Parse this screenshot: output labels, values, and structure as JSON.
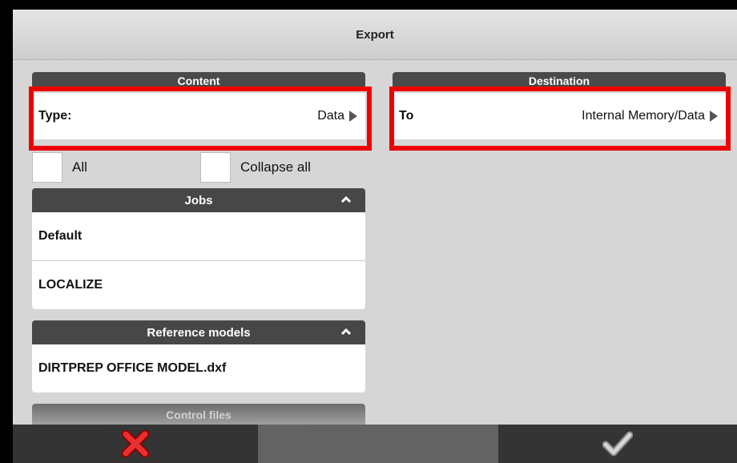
{
  "window": {
    "title": "Export"
  },
  "content": {
    "header": "Content",
    "type_label": "Type:",
    "type_value": "Data"
  },
  "destination": {
    "header": "Destination",
    "to_label": "To",
    "to_value": "Internal Memory/Data"
  },
  "options": {
    "all_label": "All",
    "collapse_label": "Collapse all"
  },
  "jobs": {
    "header": "Jobs",
    "items": [
      "Default",
      "LOCALIZE"
    ]
  },
  "reference_models": {
    "header": "Reference models",
    "items": [
      "DIRTPREP OFFICE MODEL.dxf"
    ]
  },
  "control_files": {
    "header": "Control files"
  },
  "colors": {
    "highlight": "#ee0000",
    "cancel": "#e02020",
    "ok": "#cfcfcf"
  }
}
